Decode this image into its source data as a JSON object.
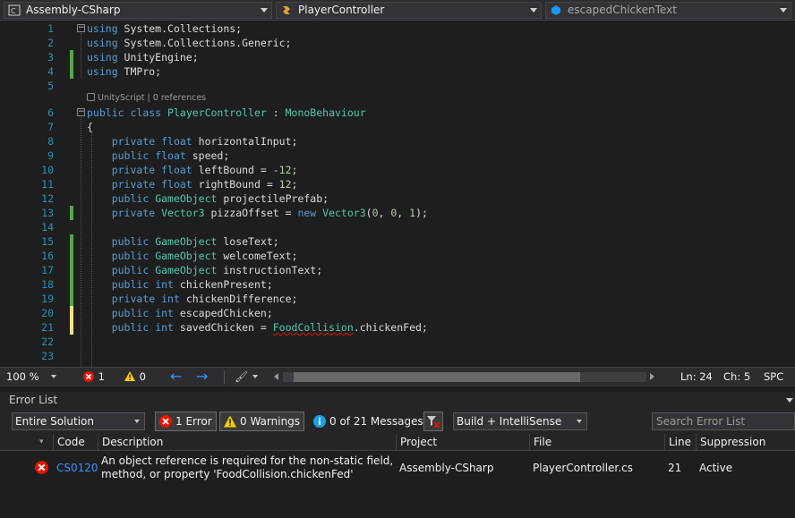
{
  "nav": {
    "project": "Assembly-CSharp",
    "class": "PlayerController",
    "member": "escapedChickenText"
  },
  "code": {
    "line_numbers": [
      "1",
      "2",
      "3",
      "4",
      "5",
      "6",
      "7",
      "8",
      "9",
      "10",
      "11",
      "12",
      "13",
      "14",
      "15",
      "16",
      "17",
      "18",
      "19",
      "20",
      "21",
      "22",
      "23"
    ],
    "codelens": "UnityScript | 0 references",
    "error_symbol": "FoodCollision",
    "error_line_suffix": ".chickenFed;"
  },
  "status": {
    "zoom": "100 %",
    "errors": "1",
    "warnings": "0",
    "line": "Ln: 24",
    "col": "Ch: 5",
    "mode": "SPC"
  },
  "error_list": {
    "title": "Error List",
    "scope": "Entire Solution",
    "errors_btn": "1 Error",
    "warnings_btn": "0 Warnings",
    "messages_btn": "0 of 21 Messages",
    "build_filter": "Build + IntelliSense",
    "search_placeholder": "Search Error List",
    "columns": {
      "code": "Code",
      "description": "Description",
      "project": "Project",
      "file": "File",
      "line": "Line",
      "suppression": "Suppression State"
    },
    "rows": [
      {
        "code": "CS0120",
        "description_1": "An object reference is required for the non-static field,",
        "description_2": "method, or property 'FoodCollision.chickenFed'",
        "project": "Assembly-CSharp",
        "file": "PlayerController.cs",
        "line": "21",
        "suppression": "Active"
      }
    ]
  },
  "colors": {
    "error": "#e51400",
    "warning": "#ffcc00",
    "info": "#1ba1e2",
    "keyword": "#569cd6",
    "type": "#4ec9b0",
    "line_number": "#2b91af",
    "change_saved": "#57a64a",
    "change_unsaved": "#efe28b"
  }
}
